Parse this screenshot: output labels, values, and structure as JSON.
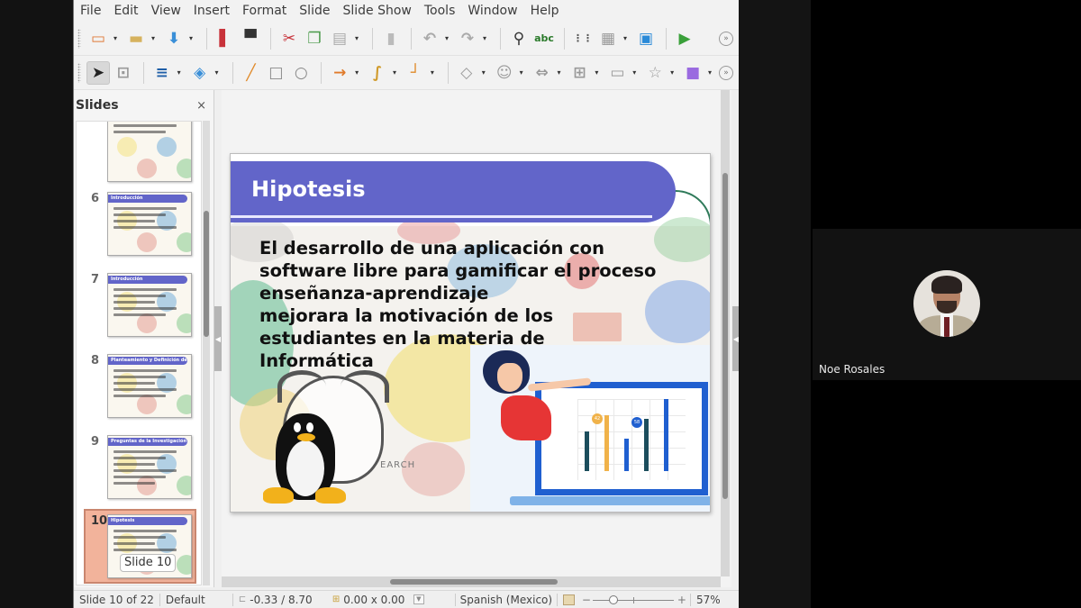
{
  "menu": [
    "File",
    "Edit",
    "View",
    "Insert",
    "Format",
    "Slide",
    "Slide Show",
    "Tools",
    "Window",
    "Help"
  ],
  "toolbar1": [
    {
      "icon": "new-presentation-icon",
      "dropdown": true
    },
    {
      "icon": "open-folder-icon",
      "dropdown": true
    },
    {
      "icon": "save-icon",
      "dropdown": true
    },
    {
      "icon": "export-pdf-icon",
      "dropdown": false
    },
    {
      "icon": "print-icon",
      "dropdown": false
    },
    {
      "icon": "cut-icon",
      "dropdown": false
    },
    {
      "icon": "copy-icon",
      "dropdown": false
    },
    {
      "icon": "paste-icon",
      "dropdown": true
    },
    {
      "icon": "clone-formatting-icon",
      "dropdown": false
    },
    {
      "icon": "undo-icon",
      "dropdown": true
    },
    {
      "icon": "redo-icon",
      "dropdown": true
    },
    {
      "icon": "find-replace-icon",
      "dropdown": false
    },
    {
      "icon": "spelling-icon",
      "dropdown": false
    },
    {
      "icon": "grid-icon",
      "dropdown": false
    },
    {
      "icon": "slide-layout-icon",
      "dropdown": true
    },
    {
      "icon": "display-views-icon",
      "dropdown": false
    },
    {
      "icon": "start-slideshow-icon",
      "dropdown": false
    }
  ],
  "toolbar2": [
    {
      "icon": "select-pointer-icon",
      "dropdown": false,
      "active": true
    },
    {
      "icon": "zoom-pan-icon",
      "dropdown": false
    },
    {
      "icon": "line-color-icon",
      "dropdown": true
    },
    {
      "icon": "fill-color-icon",
      "dropdown": true
    },
    {
      "icon": "line-tool-icon",
      "dropdown": false
    },
    {
      "icon": "rectangle-icon",
      "dropdown": false
    },
    {
      "icon": "ellipse-icon",
      "dropdown": false
    },
    {
      "icon": "arrow-line-icon",
      "dropdown": true
    },
    {
      "icon": "curve-icon",
      "dropdown": true
    },
    {
      "icon": "connector-icon",
      "dropdown": true
    },
    {
      "icon": "basic-shapes-icon",
      "dropdown": true
    },
    {
      "icon": "symbol-shapes-icon",
      "dropdown": true
    },
    {
      "icon": "block-arrows-icon",
      "dropdown": true
    },
    {
      "icon": "flowchart-icon",
      "dropdown": true
    },
    {
      "icon": "callout-icon",
      "dropdown": true
    },
    {
      "icon": "star-icon",
      "dropdown": true
    },
    {
      "icon": "3d-object-icon",
      "dropdown": true
    }
  ],
  "slides_pane": {
    "title": "Slides",
    "close": "×",
    "slides": [
      {
        "number": "",
        "title": "",
        "lines": 2
      },
      {
        "number": "6",
        "title": "Introducción",
        "lines": 4
      },
      {
        "number": "7",
        "title": "Introducción",
        "lines": 5
      },
      {
        "number": "8",
        "title": "Planteamiento y Definición del Problema",
        "lines": 5
      },
      {
        "number": "9",
        "title": "Preguntas de la Investigación",
        "lines": 6
      },
      {
        "number": "10",
        "title": "Hipotesis",
        "lines": 4,
        "selected": true
      }
    ],
    "tooltip": "Slide 10"
  },
  "slide": {
    "title": "Hipotesis",
    "body": "El desarrollo de una aplicación con\nsoftware libre para gamificar el proceso\nenseñanza-aprendizaje\nmejorara la motivación de los\nestudiantes en la materia de\nInformática",
    "colors": {
      "title_bar": "#6265c9",
      "monitor": "#1f5fd0"
    },
    "illustration_chart": {
      "bars": [
        {
          "color": "#1b4d5c",
          "value": 0.55
        },
        {
          "color": "#f0b24a",
          "value": 0.78
        },
        {
          "color": "#1f5fd0",
          "value": 0.45
        },
        {
          "color": "#1b4d5c",
          "value": 0.72
        },
        {
          "color": "#1f5fd0",
          "value": 1.0
        }
      ],
      "markers": [
        {
          "bar": 1,
          "label": "42",
          "color": "#f0b24a"
        },
        {
          "bar": 3,
          "label": "58",
          "color": "#1f5fd0"
        }
      ]
    },
    "watermark_text": "EARCH"
  },
  "statusbar": {
    "slide_position": "Slide 10 of 22",
    "master": "Default",
    "cursor_position": "-0.33 / 8.70",
    "object_size": "0.00 x 0.00",
    "language": "Spanish (Mexico)",
    "zoom_minus": "−",
    "zoom_plus": "+",
    "zoom": "57%",
    "zoom_fraction": 0.2
  },
  "participant": {
    "name": "Noe Rosales"
  }
}
